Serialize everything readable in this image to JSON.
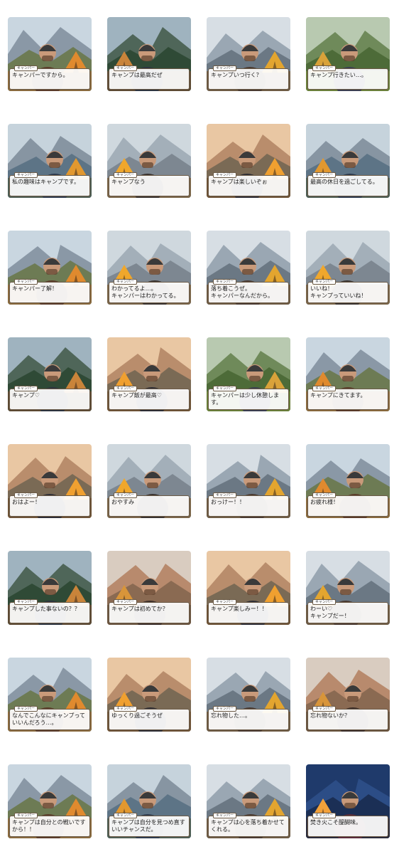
{
  "page": {
    "title": "",
    "name_tag": "キャンパー"
  },
  "stickers": [
    {
      "caption": "キャンパーですから。",
      "palette": "warm"
    },
    {
      "caption": "キャンプは最高だぜ",
      "palette": "forest"
    },
    {
      "caption": "キャンプいつ行く？",
      "palette": "mountain"
    },
    {
      "caption": "キャンプ行きたい…。",
      "palette": "meadow"
    },
    {
      "caption": "私の趣味はキャンプです。",
      "palette": "lake"
    },
    {
      "caption": "キャンプなう",
      "palette": "tent"
    },
    {
      "caption": "キャンプは楽しいぞぉ",
      "palette": "sunset"
    },
    {
      "caption": "最高の休日を過ごしてる。",
      "palette": "lake"
    },
    {
      "caption": "キャンパー了解！",
      "palette": "warm"
    },
    {
      "caption": "わかってるよ…。\nキャンパーはわかってる。",
      "palette": "tent"
    },
    {
      "caption": "落ち着こうぜ。\nキャンパーなんだから。",
      "palette": "mountain"
    },
    {
      "caption": "いいね！\nキャンプっていいね！",
      "palette": "tent"
    },
    {
      "caption": "キャンプ♡",
      "palette": "forest"
    },
    {
      "caption": "キャンプ飯が最高♡",
      "palette": "sunset"
    },
    {
      "caption": "キャンパーは少し休憩します。",
      "palette": "meadow"
    },
    {
      "caption": "キャンプにきてます。",
      "palette": "warm"
    },
    {
      "caption": "おはよー！",
      "palette": "sunset"
    },
    {
      "caption": "おやすみ",
      "palette": "tent"
    },
    {
      "caption": "おっけー！！",
      "palette": "mountain"
    },
    {
      "caption": "お疲れ様！",
      "palette": "warm"
    },
    {
      "caption": "キャンプした事ないの？？",
      "palette": "forest"
    },
    {
      "caption": "キャンプは初めてか？",
      "palette": "canyon"
    },
    {
      "caption": "キャンプ楽しみー！！",
      "palette": "sunset"
    },
    {
      "caption": "わーい♡\nキャンプだー！",
      "palette": "mountain"
    },
    {
      "caption": "なんでこんなにキャンプっていいんだろう…。",
      "palette": "warm"
    },
    {
      "caption": "ゆっくり過ごそうぜ",
      "palette": "sunset"
    },
    {
      "caption": "忘れ物した…。",
      "palette": "mountain"
    },
    {
      "caption": "忘れ物ないか？",
      "palette": "canyon"
    },
    {
      "caption": "キャンプは自分との戦いですから！！",
      "palette": "warm"
    },
    {
      "caption": "キャンプは自分を見つめ直すいいチャンスだ。",
      "palette": "lake"
    },
    {
      "caption": "キャンプは心を落ち着かせてくれる。",
      "palette": "mountain"
    },
    {
      "caption": "焚き火こそ醍醐味。",
      "palette": "night"
    }
  ],
  "palettes": {
    "warm": {
      "sky": "#c9d6e0",
      "far": "#8a98a6",
      "near": "#6d7b54",
      "ground": "#8a6a3e",
      "accent": "#e08a2e",
      "figure": "#5a3b2a"
    },
    "forest": {
      "sky": "#9fb3bf",
      "far": "#4f6659",
      "near": "#2f4a36",
      "ground": "#5d4a34",
      "accent": "#c9843a",
      "figure": "#2d3440"
    },
    "mountain": {
      "sky": "#d7dee4",
      "far": "#9aa7b3",
      "near": "#6b7884",
      "ground": "#6e5b44",
      "accent": "#e3a52f",
      "figure": "#4a3a31"
    },
    "meadow": {
      "sky": "#b8c9b0",
      "far": "#6f8a5a",
      "near": "#4d6b38",
      "ground": "#6a7f3a",
      "accent": "#d9a23a",
      "figure": "#3b3f52"
    },
    "lake": {
      "sky": "#c6d3dc",
      "far": "#8795a2",
      "near": "#5d7486",
      "ground": "#4e5e54",
      "accent": "#e2982f",
      "figure": "#2e3b4f"
    },
    "tent": {
      "sky": "#cfd8de",
      "far": "#a3afb9",
      "near": "#7d8791",
      "ground": "#7a6549",
      "accent": "#f0a72c",
      "figure": "#3a3330"
    },
    "sunset": {
      "sky": "#e9c7a3",
      "far": "#b98d6c",
      "near": "#7a6a55",
      "ground": "#6d5337",
      "accent": "#f0a030",
      "figure": "#2e2e36"
    },
    "canyon": {
      "sky": "#d9ccc0",
      "far": "#b88a6d",
      "near": "#8a6a52",
      "ground": "#6a5540",
      "accent": "#d8953a",
      "figure": "#3b2e2a"
    },
    "night": {
      "sky": "#1f3a6b",
      "far": "#2c4d86",
      "near": "#1b2f55",
      "ground": "#2a2b3a",
      "accent": "#f3a13a",
      "figure": "#5a2a3a"
    }
  }
}
